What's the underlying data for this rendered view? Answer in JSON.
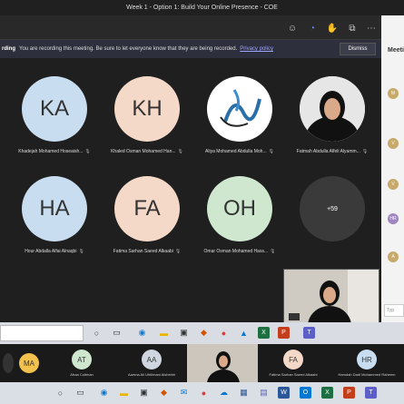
{
  "window": {
    "title": "Week 1 - Option 1: Build Your Online Presence - COE"
  },
  "toolbar": {
    "icons": [
      "people-icon",
      "chat-icon",
      "reactions-icon",
      "apps-icon",
      "more-icon"
    ]
  },
  "banner": {
    "recording_label": "rding",
    "message": "You are recording this meeting. Be sure to let everyone know that they are being recorded.",
    "policy_link": "Privacy policy",
    "dismiss": "Dismiss"
  },
  "participants": [
    {
      "initials": "KA",
      "name": "Khadejah Mohamed Hoseaish...",
      "color": "#c8def0"
    },
    {
      "initials": "KH",
      "name": "Khaled Osman Mohamed Han...",
      "color": "#f5d9c8"
    },
    {
      "initials": "",
      "name": "Aliya Mohamed Abdulla Moh...",
      "color": "#ffffff"
    },
    {
      "initials": "",
      "name": "Fatmah Abdulla Alfeli Alyamm...",
      "color": "#cfcfcf"
    },
    {
      "initials": "HA",
      "name": "Hour Abdalla Alfai Alnaqbi",
      "color": "#c8def0"
    },
    {
      "initials": "FA",
      "name": "Fatima Sarhan Saeed Alkaabi",
      "color": "#f5d9c8"
    },
    {
      "initials": "OH",
      "name": "Omar Osman Mohamed Hass...",
      "color": "#cfe7cf"
    },
    {
      "initials": "+59",
      "name": "",
      "color": "#3a3a3a"
    }
  ],
  "side_panel": {
    "title": "Meeti",
    "avatars": [
      "M",
      "V",
      "V",
      "HR",
      "A"
    ],
    "input_placeholder": "Typ"
  },
  "strip": [
    {
      "initials": "MA",
      "name": "",
      "color": "#f2c14e"
    },
    {
      "initials": "AT",
      "name": "Afraa Cultman",
      "color": "#cfe7cf"
    },
    {
      "initials": "AA",
      "name": "Aamna Ali Uhtlimani Alshehhi",
      "color": "#cfd6df"
    },
    {
      "initials": "",
      "name": "",
      "color": ""
    },
    {
      "initials": "FA",
      "name": "Fatima Sarhan Saeed Alkaabi",
      "color": "#f5d9c8"
    },
    {
      "initials": "HR",
      "name": "Hamdah Dadi Mohammed Raheem",
      "color": "#c8def0"
    }
  ]
}
